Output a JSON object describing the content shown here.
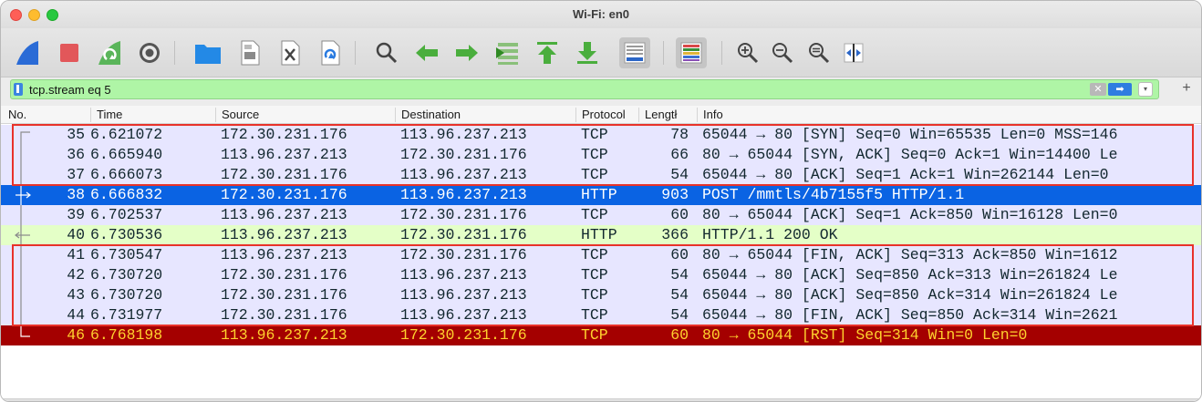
{
  "window": {
    "title": "Wi-Fi: en0"
  },
  "toolbar": {
    "icons": [
      "start-capture-icon",
      "stop-capture-icon",
      "restart-capture-icon",
      "capture-options-icon",
      "open-file-icon",
      "save-file-icon",
      "close-file-icon",
      "reload-file-icon",
      "find-packet-icon",
      "go-back-icon",
      "go-forward-icon",
      "go-to-packet-icon",
      "go-first-icon",
      "go-last-icon",
      "autoscroll-icon",
      "colorize-icon",
      "zoom-in-icon",
      "zoom-out-icon",
      "normal-size-icon",
      "resize-columns-icon"
    ]
  },
  "filter": {
    "value": "tcp.stream eq 5",
    "clear_glyph": "✕",
    "apply_glyph": "➡",
    "dropdown_glyph": "▾",
    "add_glyph": "+"
  },
  "columns": {
    "no": "No.",
    "time": "Time",
    "source": "Source",
    "destination": "Destination",
    "protocol": "Protocol",
    "length": "Lengtł",
    "info": "Info"
  },
  "colors": {
    "tcp_row": "#e7e6ff",
    "green_row": "#e4ffc7",
    "selected_row": "#0a63e3",
    "rst_row": "#a40000",
    "rst_text": "#ffd22e",
    "highlight_box": "#e8322a",
    "filter_bg": "#aff5a6"
  },
  "packets": [
    {
      "no": "35",
      "time": "6.621072",
      "src": "172.30.231.176",
      "dst": "113.96.237.213",
      "proto": "TCP",
      "len": "78",
      "info": "65044 → 80 [SYN] Seq=0 Win=65535 Len=0 MSS=146",
      "style": "tcp",
      "conv": "first"
    },
    {
      "no": "36",
      "time": "6.665940",
      "src": "113.96.237.213",
      "dst": "172.30.231.176",
      "proto": "TCP",
      "len": "66",
      "info": "80 → 65044 [SYN, ACK] Seq=0 Ack=1 Win=14400 Le",
      "style": "tcp",
      "conv": "line"
    },
    {
      "no": "37",
      "time": "6.666073",
      "src": "172.30.231.176",
      "dst": "113.96.237.213",
      "proto": "TCP",
      "len": "54",
      "info": "65044 → 80 [ACK] Seq=1 Ack=1 Win=262144 Len=0",
      "style": "tcp",
      "conv": "line"
    },
    {
      "no": "38",
      "time": "6.666832",
      "src": "172.30.231.176",
      "dst": "113.96.237.213",
      "proto": "HTTP",
      "len": "903",
      "info": "POST /mmtls/4b7155f5 HTTP/1.1",
      "style": "selected",
      "conv": "request"
    },
    {
      "no": "39",
      "time": "6.702537",
      "src": "113.96.237.213",
      "dst": "172.30.231.176",
      "proto": "TCP",
      "len": "60",
      "info": "80 → 65044 [ACK] Seq=1 Ack=850 Win=16128 Len=0",
      "style": "tcp",
      "conv": "line"
    },
    {
      "no": "40",
      "time": "6.730536",
      "src": "113.96.237.213",
      "dst": "172.30.231.176",
      "proto": "HTTP",
      "len": "366",
      "info": "HTTP/1.1 200 OK",
      "style": "green",
      "conv": "response"
    },
    {
      "no": "41",
      "time": "6.730547",
      "src": "113.96.237.213",
      "dst": "172.30.231.176",
      "proto": "TCP",
      "len": "60",
      "info": "80 → 65044 [FIN, ACK] Seq=313 Ack=850 Win=1612",
      "style": "tcp",
      "conv": "line"
    },
    {
      "no": "42",
      "time": "6.730720",
      "src": "172.30.231.176",
      "dst": "113.96.237.213",
      "proto": "TCP",
      "len": "54",
      "info": "65044 → 80 [ACK] Seq=850 Ack=313 Win=261824 Le",
      "style": "tcp",
      "conv": "line"
    },
    {
      "no": "43",
      "time": "6.730720",
      "src": "172.30.231.176",
      "dst": "113.96.237.213",
      "proto": "TCP",
      "len": "54",
      "info": "65044 → 80 [ACK] Seq=850 Ack=314 Win=261824 Le",
      "style": "tcp",
      "conv": "line"
    },
    {
      "no": "44",
      "time": "6.731977",
      "src": "172.30.231.176",
      "dst": "113.96.237.213",
      "proto": "TCP",
      "len": "54",
      "info": "65044 → 80 [FIN, ACK] Seq=850 Ack=314 Win=2621",
      "style": "tcp",
      "conv": "line"
    },
    {
      "no": "46",
      "time": "6.768198",
      "src": "113.96.237.213",
      "dst": "172.30.231.176",
      "proto": "TCP",
      "len": "60",
      "info": "80 → 65044 [RST] Seq=314 Win=0 Len=0",
      "style": "rst",
      "conv": "last"
    }
  ],
  "highlights": [
    {
      "from_row": 0,
      "to_row": 2
    },
    {
      "from_row": 6,
      "to_row": 9
    }
  ]
}
